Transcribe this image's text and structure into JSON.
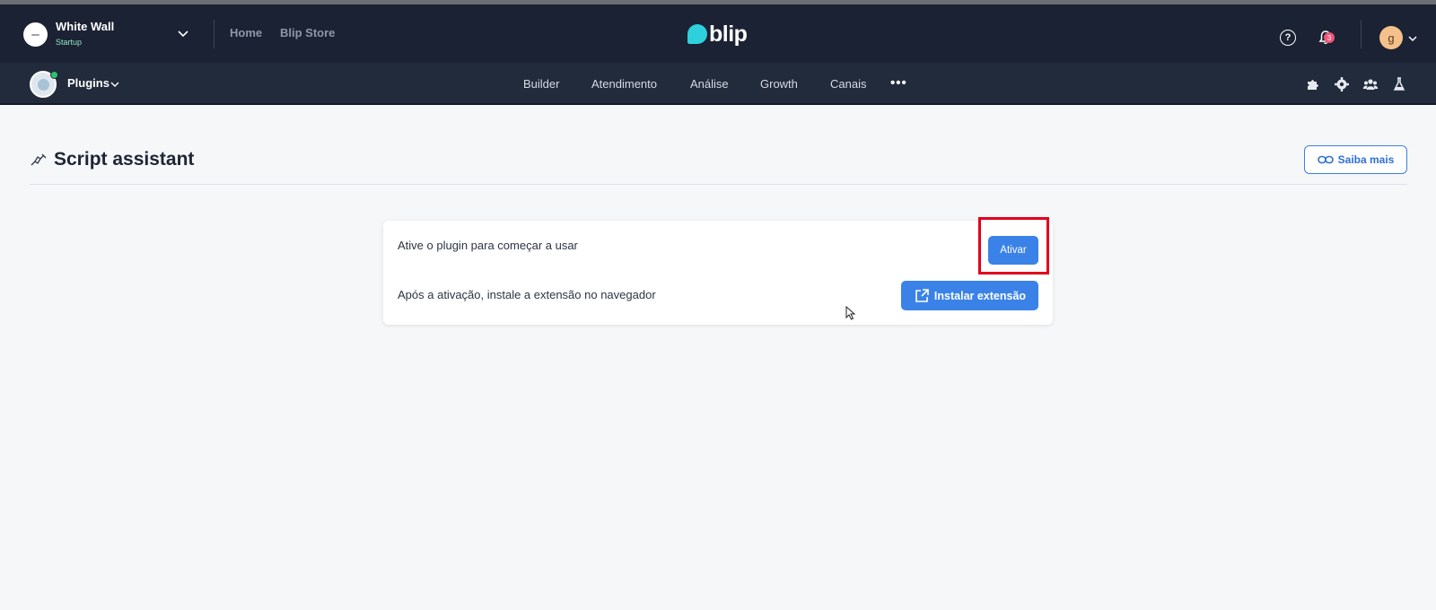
{
  "header": {
    "org_name": "White Wall",
    "org_plan": "Startup",
    "links": [
      "Home",
      "Blip Store"
    ],
    "brand": "blip",
    "notification_count": "3",
    "user_initial": "g"
  },
  "subnav": {
    "context_label": "Plugins",
    "items": [
      "Builder",
      "Atendimento",
      "Análise",
      "Growth",
      "Canais"
    ],
    "more": "•••",
    "tools": [
      "puzzle-icon",
      "gear-icon",
      "users-icon",
      "flask-icon"
    ]
  },
  "page": {
    "title": "Script assistant",
    "help_button": "Saiba mais"
  },
  "card": {
    "activate_text": "Ative o plugin para começar a usar",
    "activate_button": "Ativar",
    "install_text": "Após a ativação, instale a extensão no navegador",
    "install_button": "Instalar extensão"
  },
  "colors": {
    "topbar": "#1b2233",
    "navbar": "#222b3c",
    "primary": "#3b82e8",
    "highlight": "#e1001e",
    "online": "#2cc46b"
  }
}
